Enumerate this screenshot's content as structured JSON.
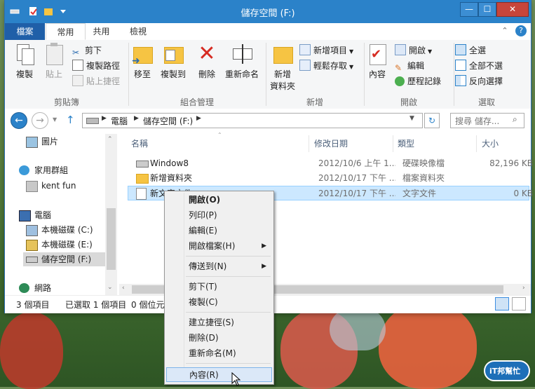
{
  "window": {
    "title": "儲存空間 (F:)",
    "min_glyph": "—",
    "max_glyph": "☐",
    "close_glyph": "✕"
  },
  "ribbon_tabs": [
    {
      "label": "檔案"
    },
    {
      "label": "常用"
    },
    {
      "label": "共用"
    },
    {
      "label": "檢視"
    }
  ],
  "help_glyph": "?",
  "ribbon": {
    "clipboard": {
      "group_label": "剪貼簿",
      "copy": "複製",
      "paste": "貼上",
      "cut": "剪下",
      "copy_path": "複製路徑",
      "paste_shortcut": "貼上捷徑"
    },
    "organize": {
      "group_label": "組合管理",
      "move_to": "移至",
      "copy_to": "複製到",
      "delete": "刪除",
      "rename": "重新命名"
    },
    "new": {
      "group_label": "新增",
      "new_folder_line1": "新增",
      "new_folder_line2": "資料夾",
      "new_item": "新增項目",
      "easy_access": "輕鬆存取"
    },
    "open": {
      "group_label": "開啟",
      "properties": "內容",
      "open": "開啟",
      "edit": "編輯",
      "history": "歷程記錄"
    },
    "select": {
      "group_label": "選取",
      "select_all": "全選",
      "select_none": "全部不選",
      "invert": "反向選擇"
    }
  },
  "address": {
    "segments": [
      "電腦",
      "儲存空間 (F:)"
    ],
    "search_placeholder": "搜尋 儲存..."
  },
  "nav_pane": {
    "items": [
      {
        "label": "圖片",
        "icon": "pictures-icon"
      },
      {
        "label": "家用群組",
        "icon": "homegroup-icon"
      },
      {
        "label": "kent fun",
        "icon": "user-icon"
      },
      {
        "label": "電腦",
        "icon": "computer-icon"
      },
      {
        "label": "本機磁碟 (C:)",
        "icon": "drive-c-icon"
      },
      {
        "label": "本機磁碟 (E:)",
        "icon": "drive-e-icon"
      },
      {
        "label": "儲存空間 (F:)",
        "icon": "drive-f-icon"
      },
      {
        "label": "網路",
        "icon": "network-icon"
      }
    ]
  },
  "file_list": {
    "columns": [
      "名稱",
      "修改日期",
      "類型",
      "大小"
    ],
    "rows": [
      {
        "name": "Window8",
        "date": "2012/10/6 上午 1...",
        "type": "硬碟映像檔",
        "size": "82,196 KB"
      },
      {
        "name": "新增資料夾",
        "date": "2012/10/17 下午 ...",
        "type": "檔案資料夾",
        "size": ""
      },
      {
        "name": "新文字文件",
        "date": "2012/10/17 下午 ...",
        "type": "文字文件",
        "size": "0 KB"
      }
    ]
  },
  "status": {
    "count": "3 個項目",
    "selected": "已選取 1 個項目",
    "size": "0 個位元"
  },
  "context_menu": {
    "items": [
      {
        "label": "開啟(O)"
      },
      {
        "label": "列印(P)"
      },
      {
        "label": "編輯(E)"
      },
      {
        "label": "開啟檔案(H)"
      },
      {
        "label": "傳送到(N)"
      },
      {
        "label": "剪下(T)"
      },
      {
        "label": "複製(C)"
      },
      {
        "label": "建立捷徑(S)"
      },
      {
        "label": "刪除(D)"
      },
      {
        "label": "重新命名(M)"
      },
      {
        "label": "內容(R)"
      }
    ],
    "submenu_arrow": "▶"
  },
  "watermark": {
    "text": "iT邦幫忙"
  },
  "colors": {
    "titlebar": "#2b82c9",
    "file_tab": "#1f5fa8",
    "selection": "#cce8ff",
    "highlight": "#dbe8f8"
  }
}
